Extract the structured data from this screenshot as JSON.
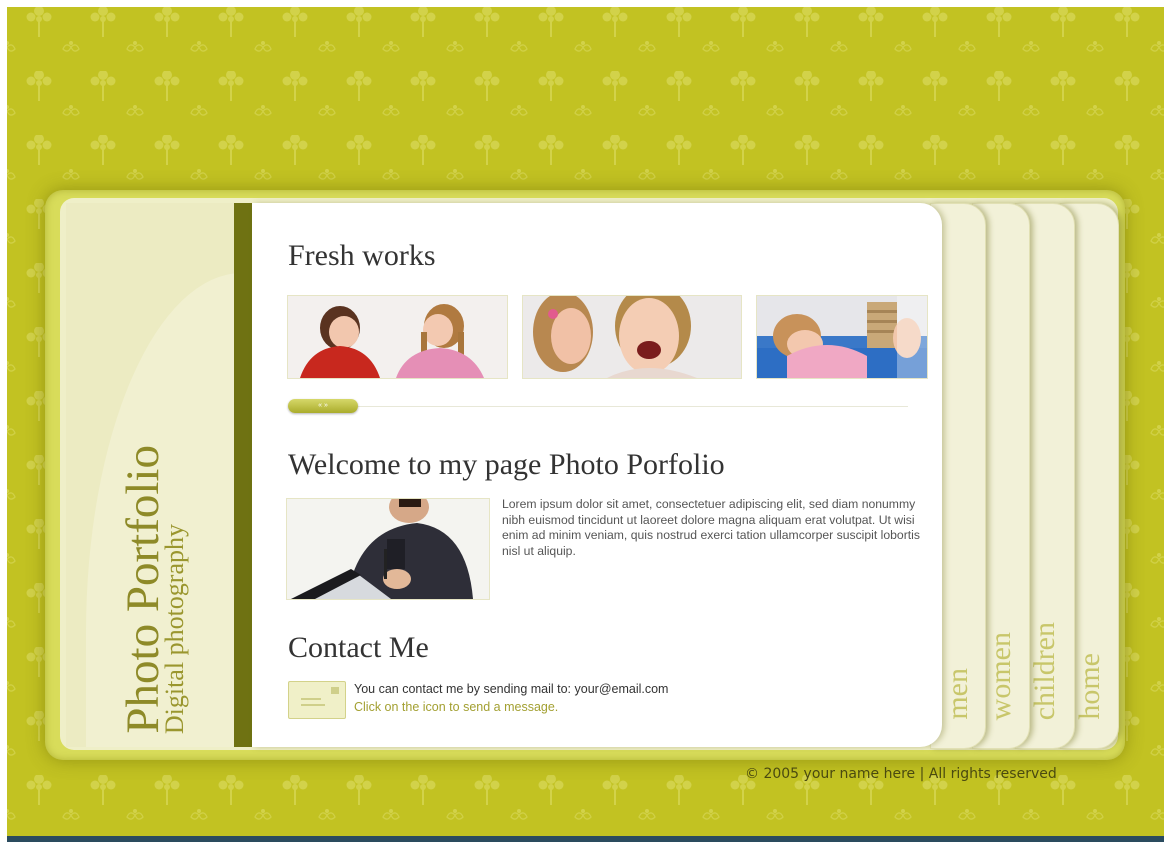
{
  "site": {
    "title": "Photo Portfolio",
    "subtitle": "Digital photography"
  },
  "nav": {
    "tabs": [
      {
        "label": "men"
      },
      {
        "label": "women"
      },
      {
        "label": "children"
      },
      {
        "label": "home"
      }
    ]
  },
  "fresh_works": {
    "heading": "Fresh works",
    "slider_label": "« »"
  },
  "welcome": {
    "heading": "Welcome to my page Photo Porfolio",
    "body": "Lorem ipsum dolor sit amet, consectetuer adipiscing elit, sed diam nonummy nibh euismod tincidunt ut laoreet dolore magna aliquam erat volutpat. Ut wisi enim ad minim veniam, quis nostrud exerci tation ullamcorper suscipit lobortis nisl ut aliquip."
  },
  "contact": {
    "heading": "Contact Me",
    "line1": "You can contact me by sending mail to: your@email.com",
    "line2": "Click on the icon to send a message."
  },
  "footer": {
    "text": "© 2005 your name here | All rights reserved"
  },
  "colors": {
    "background": "#c2c222",
    "accent_dark": "#6f7212",
    "panel": "#ecebc2",
    "tab_text": "#c8c66a"
  }
}
